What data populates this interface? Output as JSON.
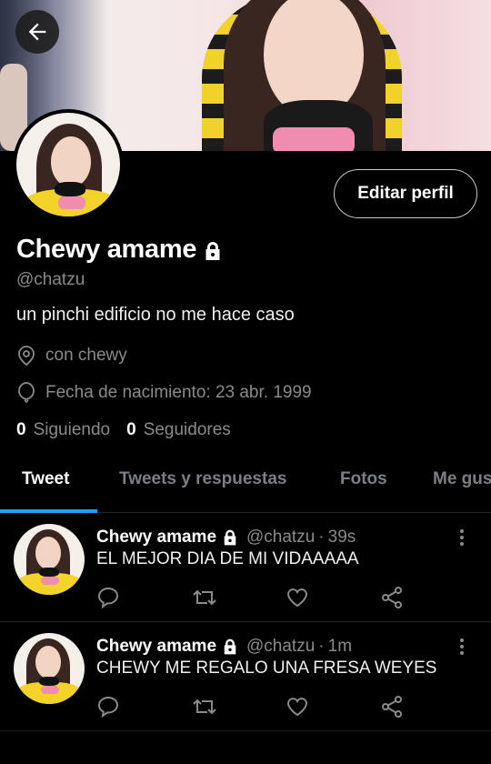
{
  "profile": {
    "name": "Chewy amame",
    "handle": "@chatzu",
    "bio": "un pinchi edificio no me hace caso",
    "location": "con chewy",
    "birthday": "Fecha de nacimiento: 23 abr. 1999",
    "following_count": "0",
    "following_label": "Siguiendo",
    "followers_count": "0",
    "followers_label": "Seguidores",
    "edit_button": "Editar perfil"
  },
  "tabs": [
    {
      "label": "Tweet",
      "active": true
    },
    {
      "label": "Tweets y respuestas",
      "active": false
    },
    {
      "label": "Fotos",
      "active": false
    },
    {
      "label": "Me gus",
      "active": false
    }
  ],
  "tweets": [
    {
      "name": "Chewy amame",
      "handle": "@chatzu",
      "time": "39s",
      "text": "EL MEJOR DIA DE MI VIDAAAAA"
    },
    {
      "name": "Chewy amame",
      "handle": "@chatzu",
      "time": "1m",
      "text": "CHEWY ME REGALO UNA FRESA WEYES"
    }
  ],
  "colors": {
    "accent": "#1da1f2",
    "background": "#000000",
    "secondary_text": "#8a8a8a"
  },
  "icons": {
    "back": "arrow-left-icon",
    "lock": "lock-icon",
    "location": "location-pin-icon",
    "birthday": "balloon-icon",
    "reply": "reply-icon",
    "retweet": "retweet-icon",
    "like": "heart-icon",
    "share": "share-icon",
    "more": "more-vertical-icon"
  }
}
